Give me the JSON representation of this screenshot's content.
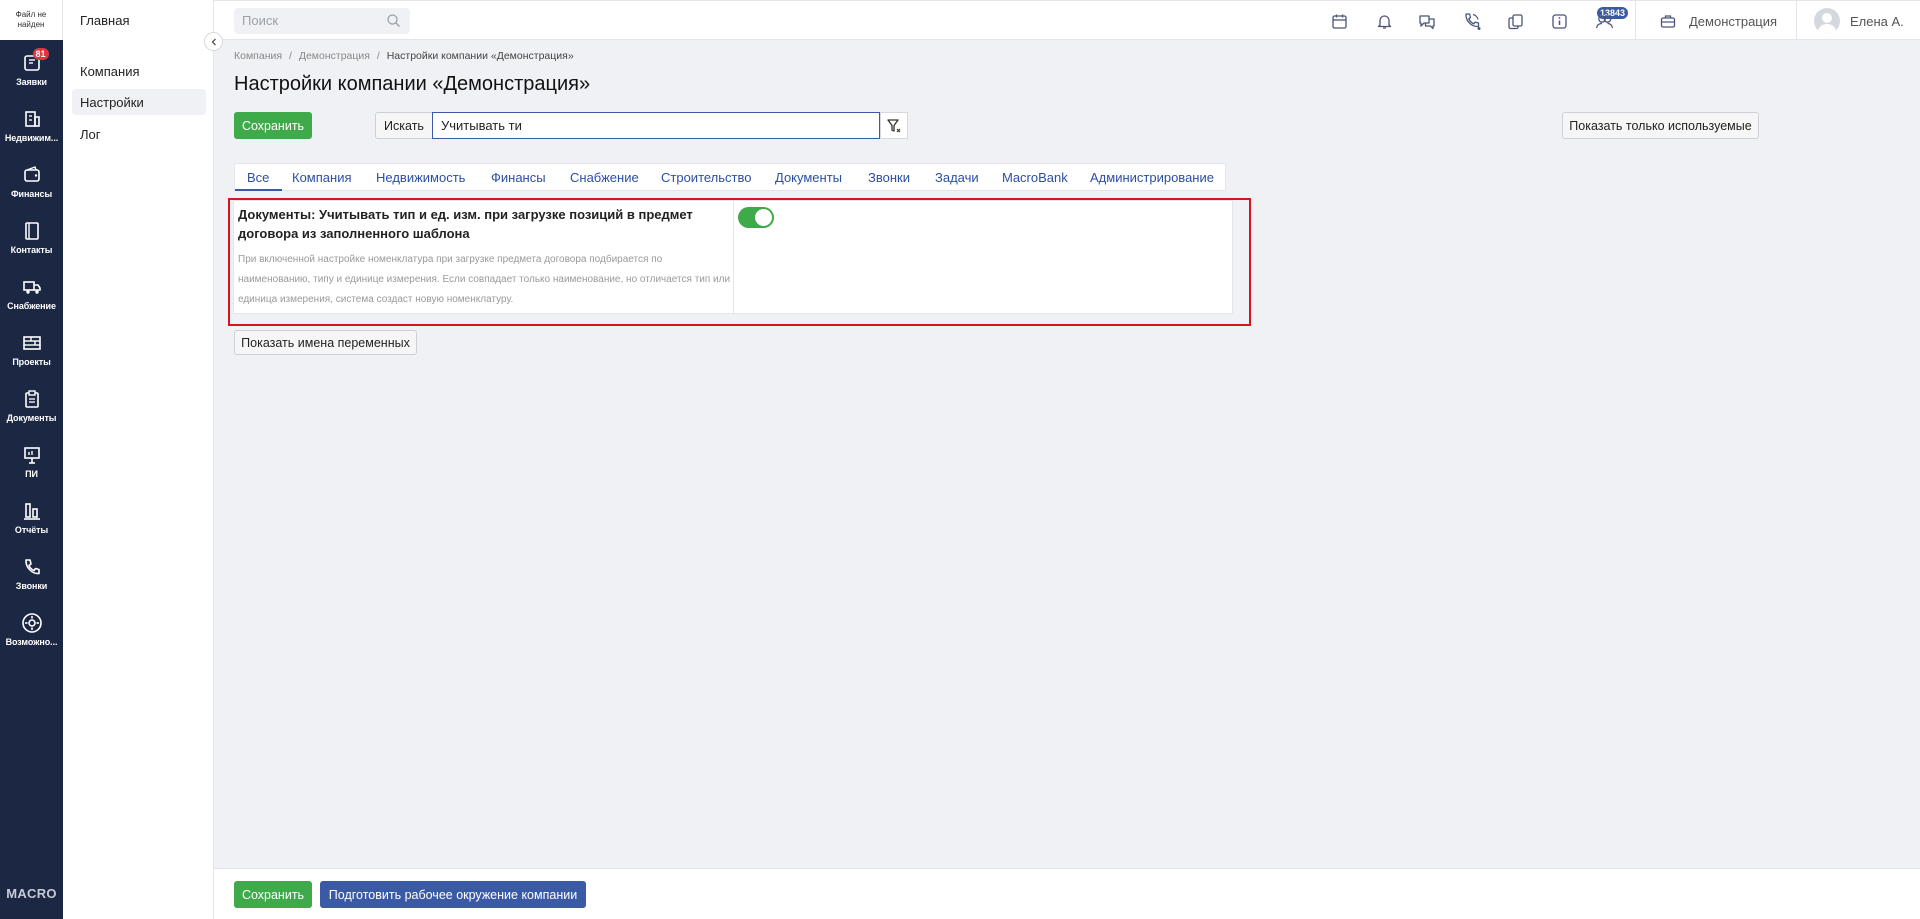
{
  "nav": {
    "file_status": "Файл не найден",
    "items": [
      {
        "label": "Заявки",
        "icon": "requests-icon",
        "badge": "81"
      },
      {
        "label": "Недвижим...",
        "icon": "building-icon"
      },
      {
        "label": "Финансы",
        "icon": "wallet-icon"
      },
      {
        "label": "Контакты",
        "icon": "contacts-icon"
      },
      {
        "label": "Снабжение",
        "icon": "truck-icon"
      },
      {
        "label": "Проекты",
        "icon": "bricks-icon"
      },
      {
        "label": "Документы",
        "icon": "clipboard-icon"
      },
      {
        "label": "ПИ",
        "icon": "presentation-icon"
      },
      {
        "label": "Отчёты",
        "icon": "reports-icon"
      },
      {
        "label": "Звонки",
        "icon": "phone-icon"
      },
      {
        "label": "Возможно...",
        "icon": "gear-icon"
      }
    ],
    "logo": "MACRO"
  },
  "subnav": {
    "title": "Главная",
    "items": [
      {
        "label": "Компания",
        "active": false
      },
      {
        "label": "Настройки",
        "active": true
      },
      {
        "label": "Лог",
        "active": false
      }
    ]
  },
  "header": {
    "search_placeholder": "Поиск",
    "notifications_count": "13843",
    "icons": [
      "calendar-icon",
      "bell-icon",
      "chat-icon",
      "phone-call-icon",
      "copy-icon",
      "info-icon",
      "users-icon"
    ],
    "company": "Демонстрация",
    "user": "Елена А."
  },
  "breadcrumbs": {
    "items": [
      "Компания",
      "Демонстрация"
    ],
    "separator": "/",
    "current": "Настройки компании «Демонстрация»"
  },
  "page": {
    "title": "Настройки компании «Демонстрация»",
    "save_label": "Сохранить",
    "search_label": "Искать",
    "search_value": "Учитывать ти",
    "show_used_label": "Показать только используемые",
    "show_vars_label": "Показать имена переменных"
  },
  "tabs": [
    {
      "label": "Все",
      "active": true
    },
    {
      "label": "Компания"
    },
    {
      "label": "Недвижимость"
    },
    {
      "label": "Финансы"
    },
    {
      "label": "Снабжение"
    },
    {
      "label": "Строительство"
    },
    {
      "label": "Документы"
    },
    {
      "label": "Звонки"
    },
    {
      "label": "Задачи"
    },
    {
      "label": "MacroBank"
    },
    {
      "label": "Администрирование"
    }
  ],
  "setting": {
    "title": "Документы: Учитывать тип и ед. изм. при загрузке позиций в предмет договора из заполненного шаблона",
    "description": "При включенной настройке номенклатура при загрузке предмета договора подбирается по наименованию, типу и единице измерения. Если совпадает только наименование, но отличается тип или единица измерения, система создаст новую номенклатуру.",
    "enabled": true
  },
  "footer": {
    "save_label": "Сохранить",
    "prepare_label": "Подготовить рабочее окружение компании"
  },
  "colors": {
    "nav_bg": "#1c2744",
    "accent_green": "#3eaa4a",
    "accent_blue": "#3b5aa6",
    "highlight_red": "#d8141d"
  }
}
